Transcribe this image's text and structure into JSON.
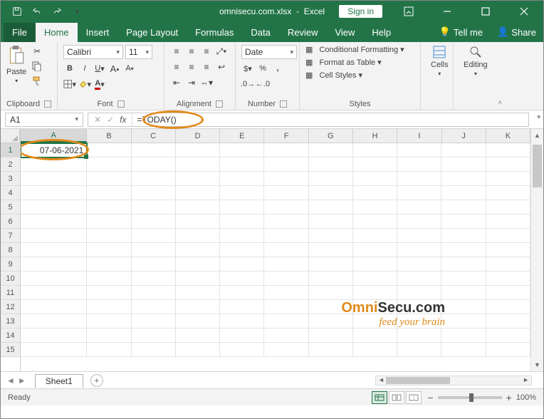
{
  "title": {
    "filename": "omnisecu.com.xlsx",
    "app": "Excel"
  },
  "titlebar": {
    "signin": "Sign in"
  },
  "tabs": {
    "file": "File",
    "home": "Home",
    "insert": "Insert",
    "pagelayout": "Page Layout",
    "formulas": "Formulas",
    "data": "Data",
    "review": "Review",
    "view": "View",
    "help": "Help",
    "tellme": "Tell me",
    "share": "Share"
  },
  "ribbon": {
    "clipboard": {
      "paste": "Paste",
      "label": "Clipboard"
    },
    "font": {
      "name": "Calibri",
      "size": "11",
      "label": "Font"
    },
    "alignment": {
      "label": "Alignment"
    },
    "number": {
      "format": "Date",
      "label": "Number"
    },
    "styles": {
      "cond": "Conditional Formatting",
      "table": "Format as Table",
      "cell": "Cell Styles",
      "label": "Styles"
    },
    "cells": {
      "label": "Cells"
    },
    "editing": {
      "label": "Editing"
    }
  },
  "formula_bar": {
    "namebox": "A1",
    "formula": "=TODAY()"
  },
  "grid": {
    "columns": [
      "A",
      "B",
      "C",
      "D",
      "E",
      "F",
      "G",
      "H",
      "I",
      "J",
      "K"
    ],
    "rows": [
      "1",
      "2",
      "3",
      "4",
      "5",
      "6",
      "7",
      "8",
      "9",
      "10",
      "11",
      "12",
      "13",
      "14",
      "15"
    ],
    "a1_value": "07-06-2021"
  },
  "sheettabs": {
    "active": "Sheet1"
  },
  "status": {
    "ready": "Ready",
    "zoom": "100%"
  },
  "watermark": {
    "brand_pre": "Omni",
    "brand_mid": "Secu",
    "brand_suf": ".com",
    "tag": "feed your brain"
  }
}
